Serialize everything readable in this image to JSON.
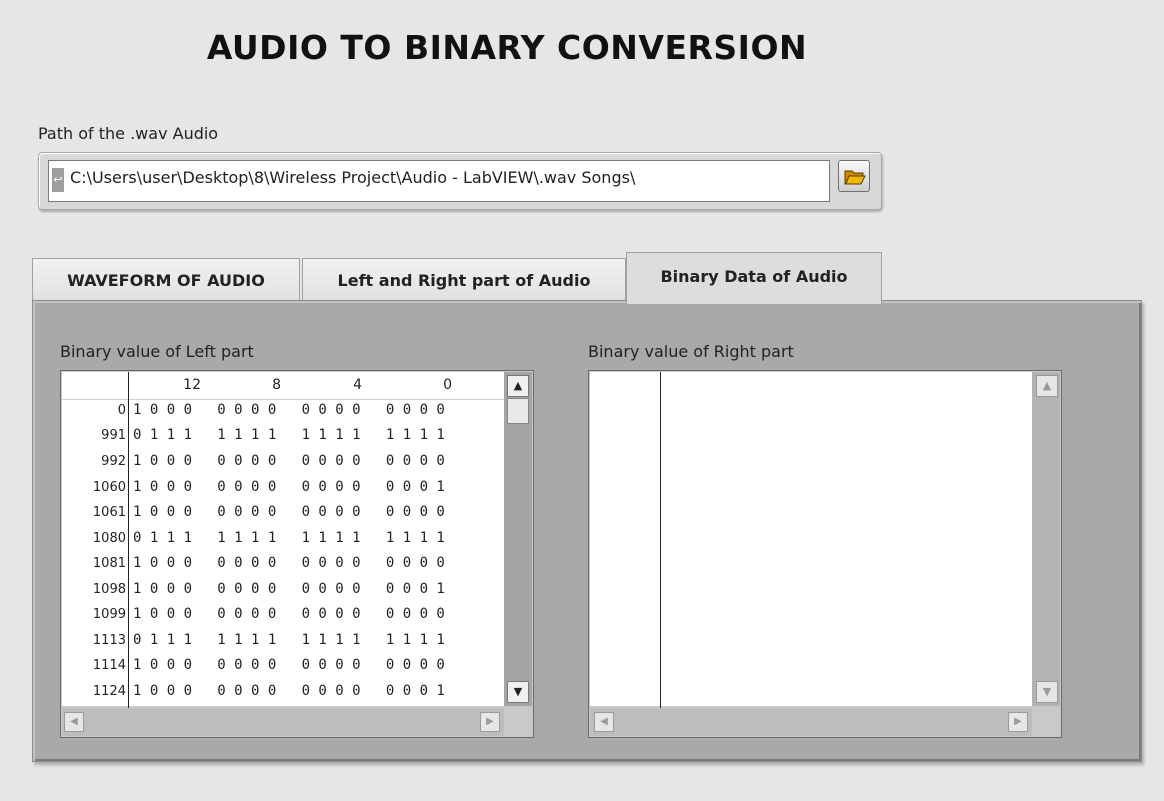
{
  "title": "AUDIO TO BINARY CONVERSION",
  "path": {
    "label": "Path of the .wav Audio",
    "value": "C:\\Users\\user\\Desktop\\8\\Wireless Project\\Audio - LabVIEW\\.wav Songs\\"
  },
  "tabs": [
    {
      "label": "WAVEFORM OF AUDIO"
    },
    {
      "label": "Left and Right part of Audio"
    },
    {
      "label": "Binary Data of Audio",
      "selected": true
    }
  ],
  "left_array": {
    "label": "Binary value of Left part",
    "column_headers": [
      "12",
      "8",
      "4",
      "0"
    ],
    "rows": [
      {
        "index": "0",
        "bits": "1 0 0 0   0 0 0 0   0 0 0 0   0 0 0 0"
      },
      {
        "index": "991",
        "bits": "0 1 1 1   1 1 1 1   1 1 1 1   1 1 1 1"
      },
      {
        "index": "992",
        "bits": "1 0 0 0   0 0 0 0   0 0 0 0   0 0 0 0"
      },
      {
        "index": "1060",
        "bits": "1 0 0 0   0 0 0 0   0 0 0 0   0 0 0 1"
      },
      {
        "index": "1061",
        "bits": "1 0 0 0   0 0 0 0   0 0 0 0   0 0 0 0"
      },
      {
        "index": "1080",
        "bits": "0 1 1 1   1 1 1 1   1 1 1 1   1 1 1 1"
      },
      {
        "index": "1081",
        "bits": "1 0 0 0   0 0 0 0   0 0 0 0   0 0 0 0"
      },
      {
        "index": "1098",
        "bits": "1 0 0 0   0 0 0 0   0 0 0 0   0 0 0 1"
      },
      {
        "index": "1099",
        "bits": "1 0 0 0   0 0 0 0   0 0 0 0   0 0 0 0"
      },
      {
        "index": "1113",
        "bits": "0 1 1 1   1 1 1 1   1 1 1 1   1 1 1 1"
      },
      {
        "index": "1114",
        "bits": "1 0 0 0   0 0 0 0   0 0 0 0   0 0 0 0"
      },
      {
        "index": "1124",
        "bits": "1 0 0 0   0 0 0 0   0 0 0 0   0 0 0 1"
      }
    ]
  },
  "right_array": {
    "label": "Binary value of Right part",
    "rows": []
  },
  "icons": {
    "path_glyph": "path-type-icon",
    "browse": "folder-open-icon"
  },
  "colors": {
    "background": "#e6e6e6",
    "panel": "#a9a9a9",
    "folder": "#e8a400"
  }
}
